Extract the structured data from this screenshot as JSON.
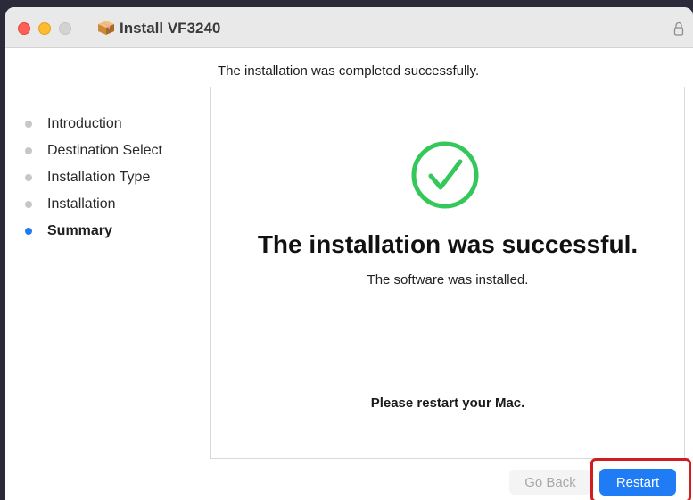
{
  "window": {
    "title": "Install VF3240",
    "icons": [
      "close-button",
      "minimize-button",
      "zoom-button",
      "package-icon",
      "lock-icon"
    ]
  },
  "header": {
    "status": "The installation was completed successfully."
  },
  "sidebar": {
    "steps": [
      {
        "label": "Introduction",
        "active": false
      },
      {
        "label": "Destination Select",
        "active": false
      },
      {
        "label": "Installation Type",
        "active": false
      },
      {
        "label": "Installation",
        "active": false
      },
      {
        "label": "Summary",
        "active": true
      }
    ]
  },
  "main": {
    "icon": "checkmark-circle-icon",
    "title": "The installation was successful.",
    "subtitle": "The software was installed.",
    "restart_message": "Please restart your Mac."
  },
  "buttons": {
    "back_label": "Go Back",
    "restart_label": "Restart"
  },
  "colors": {
    "accent": "#1f7cf5",
    "success": "#34c759",
    "highlight": "#d11d1d"
  }
}
